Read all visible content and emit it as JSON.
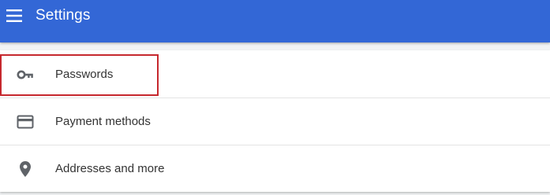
{
  "header": {
    "title": "Settings",
    "menu_icon": "hamburger-menu-icon",
    "background_color": "#3367d6"
  },
  "settings_list": {
    "items": [
      {
        "label": "Passwords",
        "icon": "key-icon",
        "highlighted": true
      },
      {
        "label": "Payment methods",
        "icon": "credit-card-icon",
        "highlighted": false
      },
      {
        "label": "Addresses and more",
        "icon": "location-pin-icon",
        "highlighted": false
      }
    ]
  },
  "colors": {
    "highlight_border": "#c6282e",
    "text": "#333333",
    "icon": "#5f6368"
  }
}
